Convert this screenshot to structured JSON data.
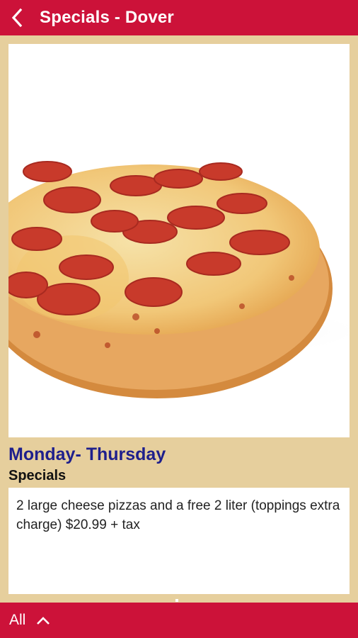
{
  "header": {
    "title": "Specials - Dover",
    "back_icon": "back-arrow-icon"
  },
  "colors": {
    "brand_red": "#cc1239",
    "panel_tan": "#e6cf9d",
    "title_blue": "#1e1f8c"
  },
  "special": {
    "day_range": "Monday- Thursday",
    "section_label": "Specials",
    "description": "2 large cheese pizzas and a free 2 liter (toppings extra charge) $20.99 + tax"
  },
  "footer": {
    "filter_label": "All",
    "expand_icon": "chevron-up-icon"
  }
}
